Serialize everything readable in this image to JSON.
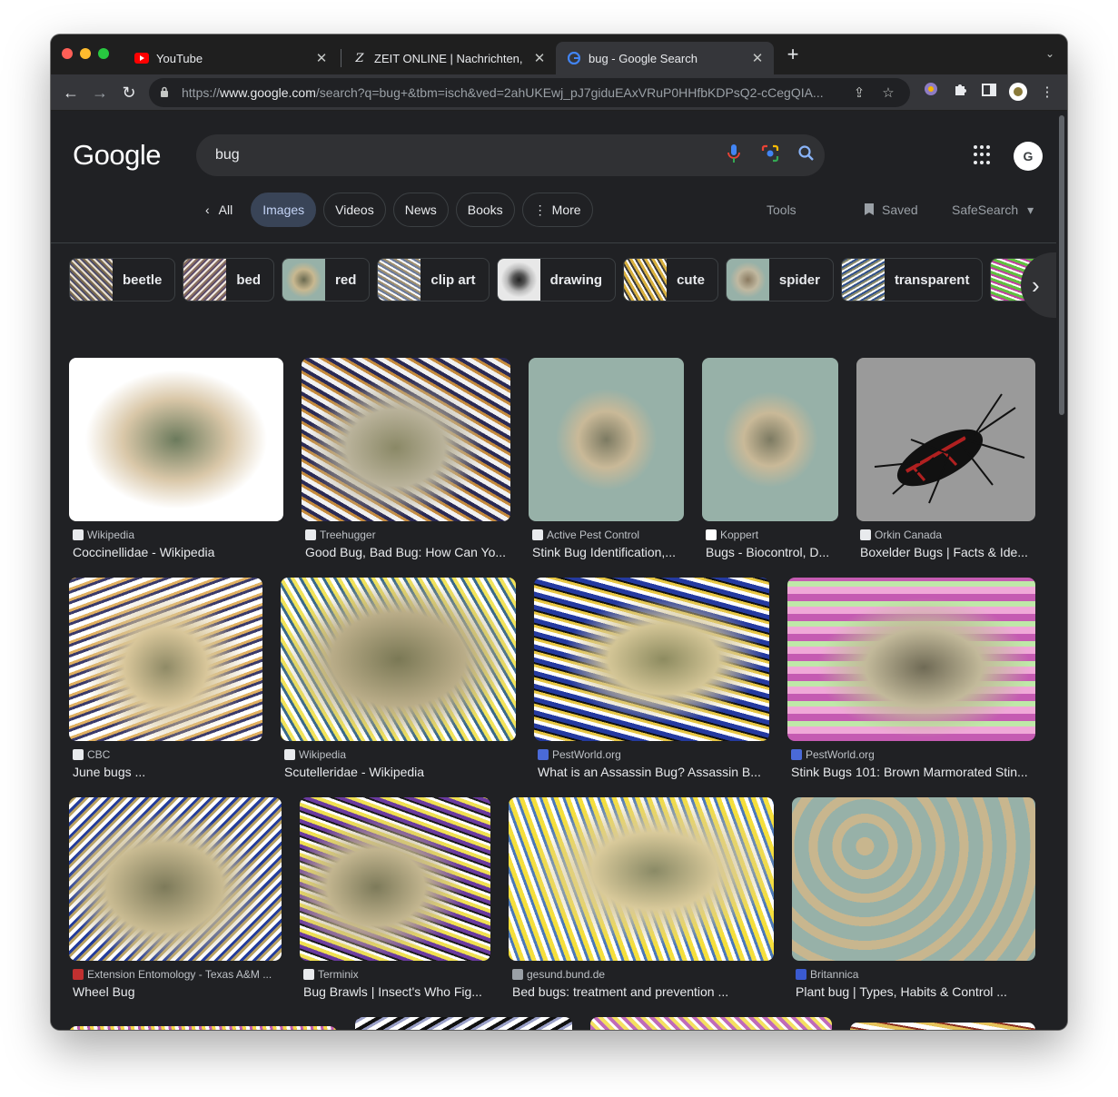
{
  "browser": {
    "tabs": [
      {
        "title": "YouTube",
        "icon": "youtube-icon"
      },
      {
        "title": "ZEIT ONLINE | Nachrichten, Ne",
        "icon": "zeit-z-icon"
      },
      {
        "title": "bug - Google Search",
        "icon": "google-icon",
        "active": true
      }
    ],
    "url_prefix": "https://",
    "url_domain": "www.google.com",
    "url_path": "/search?q=bug+&tbm=isch&ved=2ahUKEwj_pJ7giduEAxVRuP0HHfbKDPsQ2-cCegQIA..."
  },
  "google": {
    "logo_text": "Google",
    "query": "bug",
    "nav": {
      "back_label": "All",
      "tabs": [
        "Images",
        "Videos",
        "News",
        "Books",
        "More"
      ],
      "active_tab": "Images"
    },
    "tools_label": "Tools",
    "saved_label": "Saved",
    "safesearch_label": "SafeSearch",
    "refinements": [
      "beetle",
      "bed",
      "red",
      "clip art",
      "drawing",
      "cute",
      "spider",
      "transparent"
    ],
    "results": [
      {
        "source": "Wikipedia",
        "caption": "Coccinellidae - Wikipedia"
      },
      {
        "source": "Treehugger",
        "caption": "Good Bug, Bad Bug: How Can Yo..."
      },
      {
        "source": "Active Pest Control",
        "caption": "Stink Bug Identification,..."
      },
      {
        "source": "Koppert",
        "caption": "Bugs - Biocontrol, D..."
      },
      {
        "source": "Orkin Canada",
        "caption": "Boxelder Bugs | Facts & Ide..."
      },
      {
        "source": "CBC",
        "caption": "June bugs ..."
      },
      {
        "source": "Wikipedia",
        "caption": "Scutelleridae - Wikipedia"
      },
      {
        "source": "PestWorld.org",
        "caption": "What is an Assassin Bug? Assassin B..."
      },
      {
        "source": "PestWorld.org",
        "caption": "Stink Bugs 101: Brown Marmorated Stin..."
      },
      {
        "source": "Extension Entomology - Texas A&M ...",
        "caption": "Wheel Bug"
      },
      {
        "source": "Terminix",
        "caption": "Bug Brawls | Insect's Who Fig..."
      },
      {
        "source": "gesund.bund.de",
        "caption": "Bed bugs: treatment and prevention ..."
      },
      {
        "source": "Britannica",
        "caption": "Plant bug | Types, Habits & Control ..."
      }
    ]
  },
  "colors": {
    "page_bg": "#202124",
    "chrome_bg": "#35363a",
    "active_chip": "#394457",
    "text": "#e8eaed"
  }
}
